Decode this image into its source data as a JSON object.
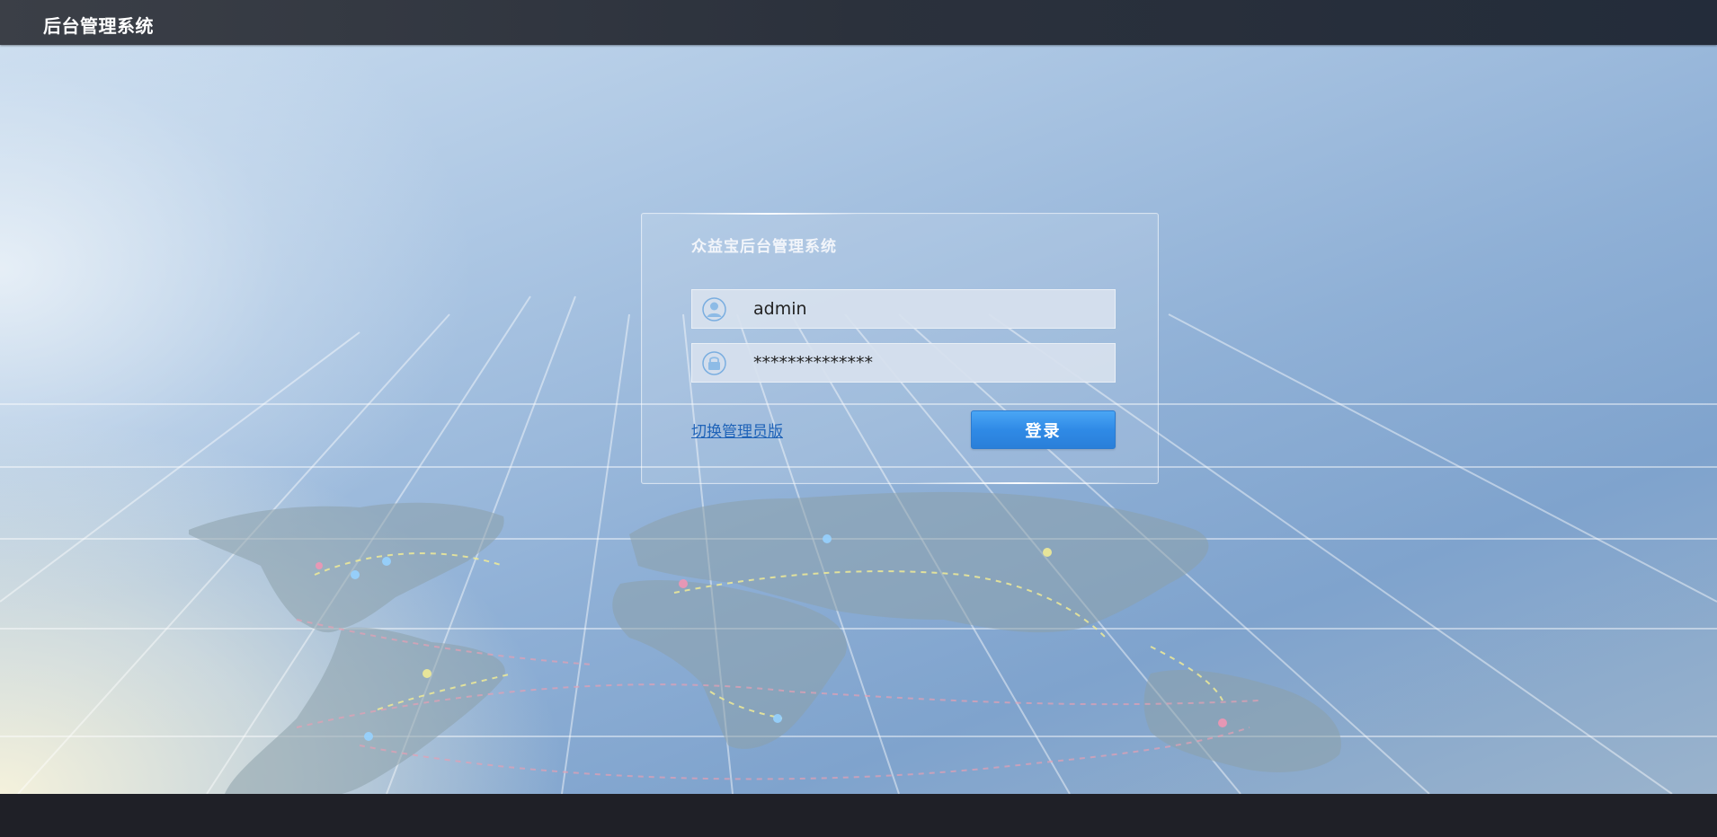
{
  "header": {
    "title": "后台管理系统"
  },
  "login": {
    "title": "众益宝后台管理系统",
    "username": {
      "value": "admin",
      "icon": "user-icon"
    },
    "password": {
      "value": "**************",
      "icon": "lock-icon"
    },
    "switch_link": "切换管理员版",
    "submit_label": "登录"
  },
  "colors": {
    "topbar": "#2b313c",
    "bottombar": "#1f2027",
    "button": "#2f8ae6",
    "link": "#1f63b8"
  }
}
